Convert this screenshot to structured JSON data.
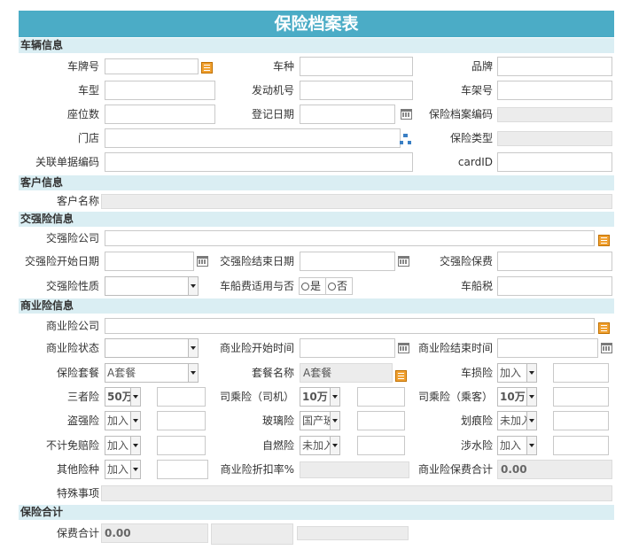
{
  "title": "保险档案表",
  "sections": {
    "vehicle": "车辆信息",
    "customer": "客户信息",
    "compulsory": "交强险信息",
    "commercial": "商业险信息",
    "total": "保险合计"
  },
  "vehicle": {
    "plate_label": "车牌号",
    "vehicle_kind_label": "车种",
    "brand_label": "品牌",
    "model_label": "车型",
    "engine_label": "发动机号",
    "frame_label": "车架号",
    "seats_label": "座位数",
    "reg_date_label": "登记日期",
    "archive_code_label": "保险档案编码",
    "store_label": "门店",
    "insurance_type_label": "保险类型",
    "related_doc_label": "关联单据编码",
    "card_id_label": "cardID"
  },
  "customer": {
    "name_label": "客户名称"
  },
  "compulsory": {
    "company_label": "交强险公司",
    "start_label": "交强险开始日期",
    "end_label": "交强险结束日期",
    "premium_label": "交强险保费",
    "nature_label": "交强险性质",
    "vessel_tax_apply_label": "车船费适用与否",
    "yes": "是",
    "no": "否",
    "vessel_tax_label": "车船税"
  },
  "commercial": {
    "company_label": "商业险公司",
    "status_label": "商业险状态",
    "start_label": "商业险开始时间",
    "end_label": "商业险结束时间",
    "package_label": "保险套餐",
    "package_value": "A套餐",
    "package_name_label": "套餐名称",
    "package_name_value": "A套餐",
    "damage_label": "车损险",
    "damage_value": "加入",
    "third_label": "三者险",
    "third_value": "50万",
    "driver_label": "司乘险（司机）",
    "driver_value": "10万",
    "passenger_label": "司乘险（乘客）",
    "passenger_value": "10万",
    "theft_label": "盗强险",
    "theft_value": "加入",
    "glass_label": "玻璃险",
    "glass_value": "国产玻",
    "scratch_label": "划痕险",
    "scratch_value": "未加入",
    "deductible_label": "不计免赔险",
    "deductible_value": "加入",
    "selfignite_label": "自燃险",
    "selfignite_value": "未加入",
    "wading_label": "涉水险",
    "wading_value": "加入",
    "other_label": "其他险种",
    "other_value": "加入",
    "discount_label": "商业险折扣率%",
    "total_label": "商业险保费合计",
    "total_value": "0.00",
    "special_label": "特殊事项"
  },
  "total": {
    "premium_label": "保费合计",
    "premium_value": "0.00"
  }
}
